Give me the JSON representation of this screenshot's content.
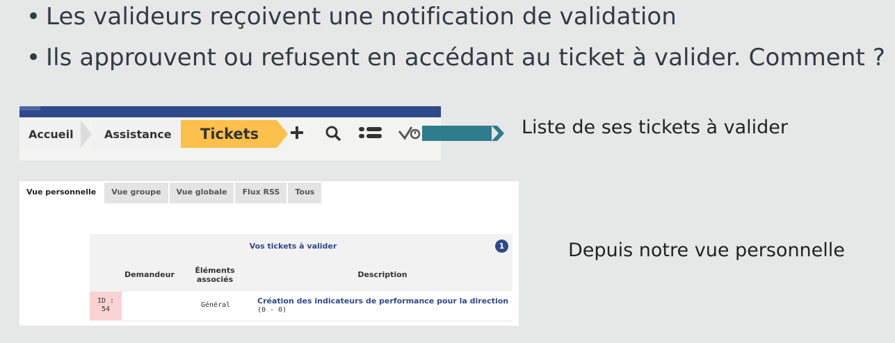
{
  "bullets": [
    {
      "symbol": "•",
      "text": "Les valideurs reçoivent une notification de validation"
    },
    {
      "symbol": "•",
      "text": "Ils approuvent ou refusent en accédant au ticket à valider. Comment ?"
    }
  ],
  "navbar": {
    "breadcrumb": [
      "Accueil",
      "Assistance",
      "Tickets"
    ],
    "icons": [
      "plus-icon",
      "search-icon",
      "list-icon",
      "validation-clock-icon"
    ],
    "accent_color": "#fcc04b",
    "top_bar_color": "#2f4a8a"
  },
  "callouts": {
    "navbar_label": "Liste de ses tickets à valider",
    "home_label": "Depuis notre vue personnelle"
  },
  "home": {
    "tabs": [
      "Vue personnelle",
      "Vue groupe",
      "Vue globale",
      "Flux RSS",
      "Tous"
    ],
    "active_tab": "Vue personnelle",
    "panel": {
      "title": "Vos tickets à valider",
      "count": "1",
      "columns": {
        "requester": "Demandeur",
        "items_line1": "Éléments",
        "items_line2": "associés",
        "description": "Description"
      },
      "rows": [
        {
          "id_line1": "ID :",
          "id_line2": "54",
          "requester": "",
          "items": "Général",
          "title": "Création des indicateurs de performance pour la direction",
          "sub": "(0 - 0)"
        }
      ]
    }
  }
}
